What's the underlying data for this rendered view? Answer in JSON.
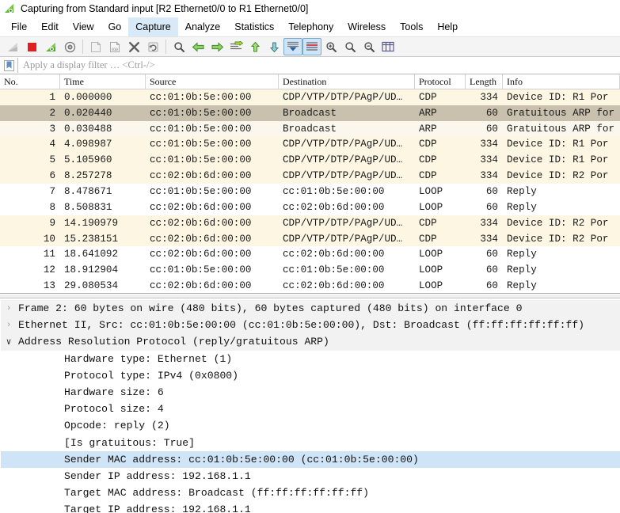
{
  "window": {
    "title": "Capturing from Standard input [R2 Ethernet0/0 to R1 Ethernet0/0]",
    "icon": "wireshark-fin-icon"
  },
  "menubar": {
    "items": [
      {
        "label": "File",
        "active": false
      },
      {
        "label": "Edit",
        "active": false
      },
      {
        "label": "View",
        "active": false
      },
      {
        "label": "Go",
        "active": false
      },
      {
        "label": "Capture",
        "active": true
      },
      {
        "label": "Analyze",
        "active": false
      },
      {
        "label": "Statistics",
        "active": false
      },
      {
        "label": "Telephony",
        "active": false
      },
      {
        "label": "Wireless",
        "active": false
      },
      {
        "label": "Tools",
        "active": false
      },
      {
        "label": "Help",
        "active": false
      }
    ]
  },
  "toolbar": {
    "buttons": [
      {
        "name": "start-capture-icon",
        "selected": false
      },
      {
        "name": "stop-capture-icon",
        "selected": false
      },
      {
        "name": "restart-capture-icon",
        "selected": false
      },
      {
        "name": "capture-options-icon",
        "selected": false
      },
      {
        "name": "separator",
        "selected": false
      },
      {
        "name": "open-file-icon",
        "selected": false
      },
      {
        "name": "save-file-icon",
        "selected": false
      },
      {
        "name": "close-file-icon",
        "selected": false
      },
      {
        "name": "reload-file-icon",
        "selected": false
      },
      {
        "name": "separator",
        "selected": false
      },
      {
        "name": "find-packet-icon",
        "selected": false
      },
      {
        "name": "go-back-icon",
        "selected": false
      },
      {
        "name": "go-forward-icon",
        "selected": false
      },
      {
        "name": "go-to-packet-icon",
        "selected": false
      },
      {
        "name": "go-to-first-icon",
        "selected": false
      },
      {
        "name": "go-to-last-icon",
        "selected": false
      },
      {
        "name": "auto-scroll-icon",
        "selected": true
      },
      {
        "name": "colorize-packets-icon",
        "selected": true
      },
      {
        "name": "zoom-in-icon",
        "selected": false
      },
      {
        "name": "zoom-out-icon",
        "selected": false
      },
      {
        "name": "normal-size-icon",
        "selected": false
      },
      {
        "name": "resize-columns-icon",
        "selected": false
      }
    ]
  },
  "filter": {
    "bookmark_icon": "bookmark-icon",
    "placeholder": "Apply a display filter … <Ctrl-/>",
    "value": ""
  },
  "packet_list": {
    "columns": [
      {
        "key": "no",
        "label": "No."
      },
      {
        "key": "time",
        "label": "Time"
      },
      {
        "key": "src",
        "label": "Source"
      },
      {
        "key": "dst",
        "label": "Destination"
      },
      {
        "key": "proto",
        "label": "Protocol"
      },
      {
        "key": "len",
        "label": "Length"
      },
      {
        "key": "info",
        "label": "Info"
      }
    ],
    "rows": [
      {
        "no": "1",
        "time": "0.000000",
        "src": "cc:01:0b:5e:00:00",
        "dst": "CDP/VTP/DTP/PAgP/UD…",
        "proto": "CDP",
        "len": "334",
        "info": "Device ID: R1  Por",
        "bg": "#fdf6e3",
        "selected": false
      },
      {
        "no": "2",
        "time": "0.020440",
        "src": "cc:01:0b:5e:00:00",
        "dst": "Broadcast",
        "proto": "ARP",
        "len": "60",
        "info": "Gratuitous ARP for",
        "bg": "#c9c1ae",
        "selected": true
      },
      {
        "no": "3",
        "time": "0.030488",
        "src": "cc:01:0b:5e:00:00",
        "dst": "Broadcast",
        "proto": "ARP",
        "len": "60",
        "info": "Gratuitous ARP for",
        "bg": "#fbf7ed",
        "selected": false
      },
      {
        "no": "4",
        "time": "4.098987",
        "src": "cc:01:0b:5e:00:00",
        "dst": "CDP/VTP/DTP/PAgP/UD…",
        "proto": "CDP",
        "len": "334",
        "info": "Device ID: R1  Por",
        "bg": "#fdf6e3",
        "selected": false
      },
      {
        "no": "5",
        "time": "5.105960",
        "src": "cc:01:0b:5e:00:00",
        "dst": "CDP/VTP/DTP/PAgP/UD…",
        "proto": "CDP",
        "len": "334",
        "info": "Device ID: R1  Por",
        "bg": "#fdf6e3",
        "selected": false
      },
      {
        "no": "6",
        "time": "8.257278",
        "src": "cc:02:0b:6d:00:00",
        "dst": "CDP/VTP/DTP/PAgP/UD…",
        "proto": "CDP",
        "len": "334",
        "info": "Device ID: R2  Por",
        "bg": "#fdf6e3",
        "selected": false
      },
      {
        "no": "7",
        "time": "8.478671",
        "src": "cc:01:0b:5e:00:00",
        "dst": "cc:01:0b:5e:00:00",
        "proto": "LOOP",
        "len": "60",
        "info": "Reply",
        "bg": "#ffffff",
        "selected": false
      },
      {
        "no": "8",
        "time": "8.508831",
        "src": "cc:02:0b:6d:00:00",
        "dst": "cc:02:0b:6d:00:00",
        "proto": "LOOP",
        "len": "60",
        "info": "Reply",
        "bg": "#ffffff",
        "selected": false
      },
      {
        "no": "9",
        "time": "14.190979",
        "src": "cc:02:0b:6d:00:00",
        "dst": "CDP/VTP/DTP/PAgP/UD…",
        "proto": "CDP",
        "len": "334",
        "info": "Device ID: R2  Por",
        "bg": "#fdf6e3",
        "selected": false
      },
      {
        "no": "10",
        "time": "15.238151",
        "src": "cc:02:0b:6d:00:00",
        "dst": "CDP/VTP/DTP/PAgP/UD…",
        "proto": "CDP",
        "len": "334",
        "info": "Device ID: R2  Por",
        "bg": "#fdf6e3",
        "selected": false
      },
      {
        "no": "11",
        "time": "18.641092",
        "src": "cc:02:0b:6d:00:00",
        "dst": "cc:02:0b:6d:00:00",
        "proto": "LOOP",
        "len": "60",
        "info": "Reply",
        "bg": "#ffffff",
        "selected": false
      },
      {
        "no": "12",
        "time": "18.912904",
        "src": "cc:01:0b:5e:00:00",
        "dst": "cc:01:0b:5e:00:00",
        "proto": "LOOP",
        "len": "60",
        "info": "Reply",
        "bg": "#ffffff",
        "selected": false
      },
      {
        "no": "13",
        "time": "29.080534",
        "src": "cc:02:0b:6d:00:00",
        "dst": "cc:02:0b:6d:00:00",
        "proto": "LOOP",
        "len": "60",
        "info": "Reply",
        "bg": "#ffffff",
        "selected": false
      }
    ]
  },
  "packet_detail": {
    "rows": [
      {
        "text": "Frame 2: 60 bytes on wire (480 bits), 60 bytes captured (480 bits) on interface 0",
        "twisty": "collapsed",
        "indent": 0,
        "highlight": false,
        "shaded": true
      },
      {
        "text": "Ethernet II, Src: cc:01:0b:5e:00:00 (cc:01:0b:5e:00:00), Dst: Broadcast (ff:ff:ff:ff:ff:ff)",
        "twisty": "collapsed",
        "indent": 0,
        "highlight": false,
        "shaded": true
      },
      {
        "text": "Address Resolution Protocol (reply/gratuitous ARP)",
        "twisty": "expanded",
        "indent": 0,
        "highlight": false,
        "shaded": true
      },
      {
        "text": "Hardware type: Ethernet (1)",
        "twisty": "none",
        "indent": 1,
        "highlight": false,
        "shaded": false
      },
      {
        "text": "Protocol type: IPv4 (0x0800)",
        "twisty": "none",
        "indent": 1,
        "highlight": false,
        "shaded": false
      },
      {
        "text": "Hardware size: 6",
        "twisty": "none",
        "indent": 1,
        "highlight": false,
        "shaded": false
      },
      {
        "text": "Protocol size: 4",
        "twisty": "none",
        "indent": 1,
        "highlight": false,
        "shaded": false
      },
      {
        "text": "Opcode: reply (2)",
        "twisty": "none",
        "indent": 1,
        "highlight": false,
        "shaded": false
      },
      {
        "text": "[Is gratuitous: True]",
        "twisty": "none",
        "indent": 1,
        "highlight": false,
        "shaded": false
      },
      {
        "text": "Sender MAC address: cc:01:0b:5e:00:00 (cc:01:0b:5e:00:00)",
        "twisty": "none",
        "indent": 1,
        "highlight": true,
        "shaded": false
      },
      {
        "text": "Sender IP address: 192.168.1.1",
        "twisty": "none",
        "indent": 1,
        "highlight": false,
        "shaded": false
      },
      {
        "text": "Target MAC address: Broadcast (ff:ff:ff:ff:ff:ff)",
        "twisty": "none",
        "indent": 1,
        "highlight": false,
        "shaded": false
      },
      {
        "text": "Target IP address: 192.168.1.1",
        "twisty": "none",
        "indent": 1,
        "highlight": false,
        "shaded": false
      }
    ]
  },
  "colors": {
    "menu_active_bg": "#d8eaf8",
    "row_cdp_bg": "#fdf6e3",
    "row_selected_bg": "#c9c1ae",
    "row_default_bg": "#ffffff",
    "detail_highlight_bg": "#cfe5f7",
    "toolbar_selected_bg": "#cfe4f7"
  }
}
